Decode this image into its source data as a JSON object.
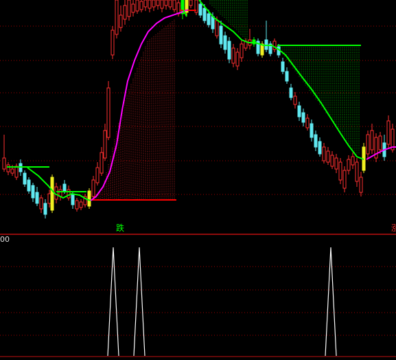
{
  "chart_data": [
    {
      "type": "candlestick",
      "title": "",
      "grid": true,
      "markers": [
        {
          "x_index": 4,
          "text": "跌",
          "color": "#00ff00"
        },
        {
          "x_index": 15,
          "text": "涨",
          "color": "#ff3030"
        }
      ],
      "note_top_right_cut": "",
      "series": [
        {
          "color": "#00ff00"
        },
        {
          "color": "#ff00ff"
        }
      ]
    },
    {
      "type": "line",
      "title": "",
      "axis_label_left": "00",
      "color": "#ffffff",
      "spikes": [
        {
          "x_index": 4,
          "value": 100
        },
        {
          "x_index": 5,
          "value": 100
        },
        {
          "x_index": 12,
          "value": 100
        }
      ]
    }
  ],
  "colors": {
    "background": "#000000",
    "grid": "#a00000",
    "divider": "#c01010",
    "up_candle": "#ff3030",
    "down_candle": "#60e8f0",
    "signal_candle": "#f0f020",
    "neutral_candle": "#00ff00",
    "support_line": "#00ff00",
    "ma_line": "#ff00ff",
    "baseline_red": "#ff0000",
    "spike_line": "#ffffff"
  },
  "footer_text": "",
  "marker_labels": {
    "fall": "跌",
    "rise": "涨"
  },
  "lower_axis_label": "00"
}
